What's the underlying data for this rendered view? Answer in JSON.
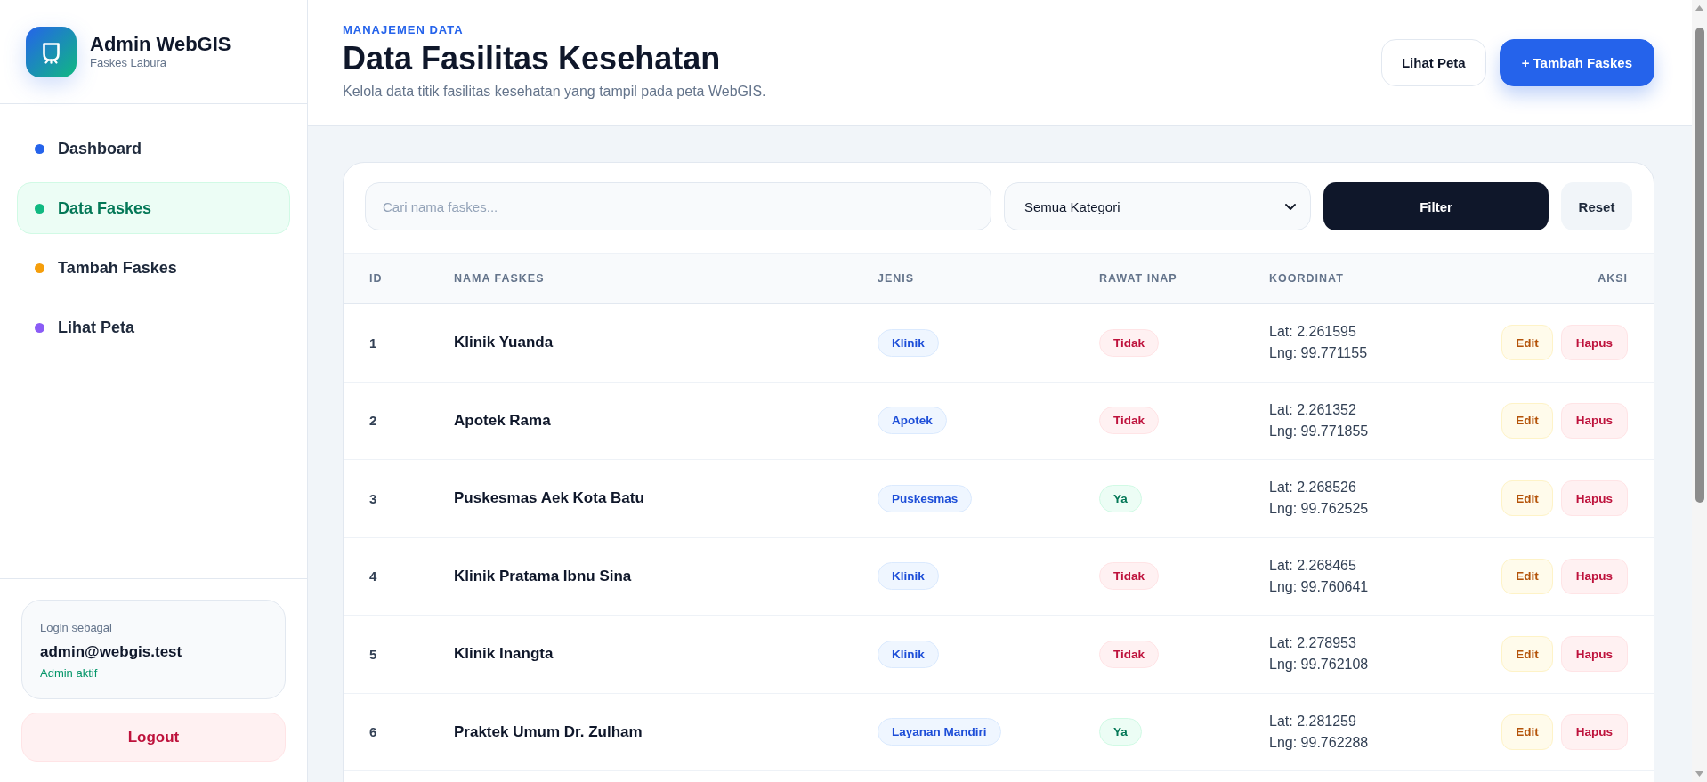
{
  "sidebar": {
    "brand": {
      "title": "Admin WebGIS",
      "subtitle": "Faskes Labura"
    },
    "nav": [
      {
        "label": "Dashboard",
        "color": "#2563eb",
        "selected": false
      },
      {
        "label": "Data Faskes",
        "color": "#10b981",
        "selected": true
      },
      {
        "label": "Tambah Faskes",
        "color": "#f59e0b",
        "selected": false
      },
      {
        "label": "Lihat Peta",
        "color": "#8b5cf6",
        "selected": false
      }
    ],
    "user": {
      "caption": "Login sebagai",
      "email": "admin@webgis.test",
      "status": "Admin aktif"
    },
    "logout": {
      "label": "Logout"
    }
  },
  "header": {
    "eyebrow": "MANAJEMEN DATA",
    "title": "Data Fasilitas Kesehatan",
    "subtitle": "Kelola data titik fasilitas kesehatan yang tampil pada peta WebGIS.",
    "actions": [
      {
        "label": "Lihat Peta",
        "kind": "secondary"
      },
      {
        "label": "+ Tambah Faskes",
        "kind": "primary"
      }
    ]
  },
  "filters": {
    "search": {
      "placeholder": "Cari nama faskes..."
    },
    "category": {
      "value": "Semua Kategori"
    },
    "buttons": [
      {
        "label": "Filter",
        "kind": "primary"
      },
      {
        "label": "Reset",
        "kind": "secondary"
      }
    ]
  },
  "table": {
    "columns": [
      "ID",
      "NAMA FASKES",
      "JENIS",
      "RAWAT INAP",
      "KOORDINAT",
      "AKSI"
    ],
    "rows": [
      {
        "id": "1",
        "name": "Klinik Yuanda",
        "type": "Klinik",
        "inpatient": {
          "label": "Tidak",
          "available": false
        },
        "lat": "Lat: 2.261595",
        "lng": "Lng: 99.771155",
        "actions": [
          {
            "label": "Edit",
            "kind": "edit"
          },
          {
            "label": "Hapus",
            "kind": "delete"
          }
        ]
      },
      {
        "id": "2",
        "name": "Apotek Rama",
        "type": "Apotek",
        "inpatient": {
          "label": "Tidak",
          "available": false
        },
        "lat": "Lat: 2.261352",
        "lng": "Lng: 99.771855",
        "actions": [
          {
            "label": "Edit",
            "kind": "edit"
          },
          {
            "label": "Hapus",
            "kind": "delete"
          }
        ]
      },
      {
        "id": "3",
        "name": "Puskesmas Aek Kota Batu",
        "type": "Puskesmas",
        "inpatient": {
          "label": "Ya",
          "available": true
        },
        "lat": "Lat: 2.268526",
        "lng": "Lng: 99.762525",
        "actions": [
          {
            "label": "Edit",
            "kind": "edit"
          },
          {
            "label": "Hapus",
            "kind": "delete"
          }
        ]
      },
      {
        "id": "4",
        "name": "Klinik Pratama Ibnu Sina",
        "type": "Klinik",
        "inpatient": {
          "label": "Tidak",
          "available": false
        },
        "lat": "Lat: 2.268465",
        "lng": "Lng: 99.760641",
        "actions": [
          {
            "label": "Edit",
            "kind": "edit"
          },
          {
            "label": "Hapus",
            "kind": "delete"
          }
        ]
      },
      {
        "id": "5",
        "name": "Klinik Inangta",
        "type": "Klinik",
        "inpatient": {
          "label": "Tidak",
          "available": false
        },
        "lat": "Lat: 2.278953",
        "lng": "Lng: 99.762108",
        "actions": [
          {
            "label": "Edit",
            "kind": "edit"
          },
          {
            "label": "Hapus",
            "kind": "delete"
          }
        ]
      },
      {
        "id": "6",
        "name": "Praktek Umum Dr. Zulham",
        "type": "Layanan Mandiri",
        "inpatient": {
          "label": "Ya",
          "available": true
        },
        "lat": "Lat: 2.281259",
        "lng": "Lng: 99.762288",
        "actions": [
          {
            "label": "Edit",
            "kind": "edit"
          },
          {
            "label": "Hapus",
            "kind": "delete"
          }
        ]
      }
    ]
  }
}
